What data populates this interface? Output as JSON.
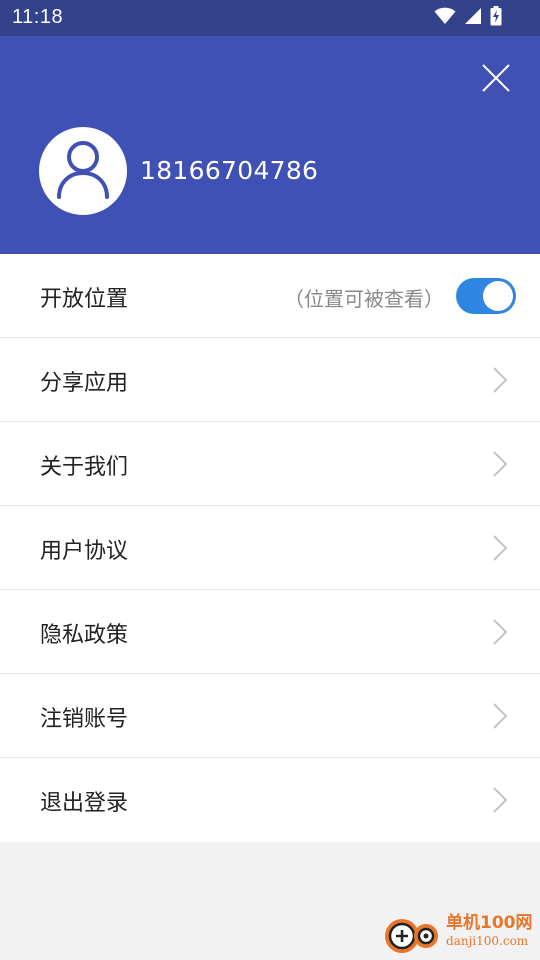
{
  "status_bar": {
    "time": "11:18",
    "icons": [
      "wifi-icon",
      "cellular-signal-icon",
      "battery-charging-icon"
    ]
  },
  "header": {
    "background_color": "#3f51b5",
    "phone_number": "18166704786",
    "close_icon": "close-icon",
    "avatar_icon": "user-avatar-icon"
  },
  "menu": {
    "open_location": {
      "label": "开放位置",
      "hint": "（位置可被查看）",
      "toggle_on": true,
      "toggle_color": "#2f86e0"
    },
    "items": [
      {
        "label": "分享应用"
      },
      {
        "label": "关于我们"
      },
      {
        "label": "用户协议"
      },
      {
        "label": "隐私政策"
      },
      {
        "label": "注销账号"
      },
      {
        "label": "退出登录"
      }
    ]
  },
  "watermark": {
    "title": "单机100网",
    "url": "danji100.com"
  }
}
